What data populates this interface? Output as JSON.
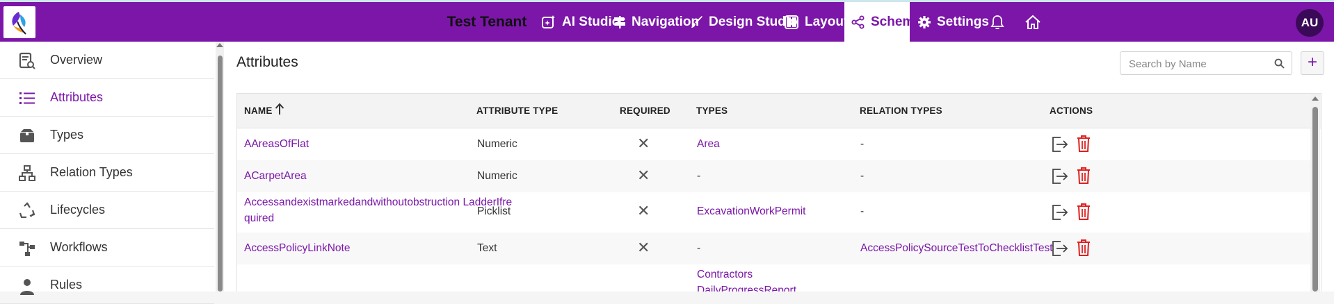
{
  "header": {
    "tenant": "Test Tenant",
    "nav": [
      {
        "label": "AI Studio",
        "icon": "ai-studio-icon"
      },
      {
        "label": "Navigation",
        "icon": "signpost-icon"
      },
      {
        "label": "Design Studio",
        "icon": "brush-icon"
      },
      {
        "label": "Layouts",
        "icon": "layout-icon"
      },
      {
        "label": "Schema",
        "icon": "share-icon",
        "active": true
      },
      {
        "label": "Settings",
        "icon": "gear-icon"
      }
    ],
    "avatar": "AU",
    "colors": {
      "primary": "#7b16a8",
      "avatar_bg": "#3a0a58"
    }
  },
  "sidebar": {
    "items": [
      {
        "label": "Overview",
        "icon": "overview-icon"
      },
      {
        "label": "Attributes",
        "icon": "list-icon",
        "active": true
      },
      {
        "label": "Types",
        "icon": "box-icon"
      },
      {
        "label": "Relation Types",
        "icon": "hierarchy-icon"
      },
      {
        "label": "Lifecycles",
        "icon": "recycle-icon"
      },
      {
        "label": "Workflows",
        "icon": "workflow-icon"
      },
      {
        "label": "Rules",
        "icon": "user-icon"
      }
    ]
  },
  "main": {
    "title": "Attributes",
    "search_placeholder": "Search by Name",
    "add_label": "+",
    "columns": [
      "NAME",
      "ATTRIBUTE TYPE",
      "REQUIRED",
      "TYPES",
      "RELATION TYPES",
      "ACTIONS"
    ],
    "rows": [
      {
        "name": "AAreasOfFlat",
        "attribute_type": "Numeric",
        "required": "✕",
        "types": "Area",
        "relation_types": "-"
      },
      {
        "name": "ACarpetArea",
        "attribute_type": "Numeric",
        "required": "✕",
        "types": "-",
        "relation_types": "-"
      },
      {
        "name_line1": "Accessandexistmarkedandwithoutobstruction LadderIfre",
        "name_line2": "quired",
        "attribute_type": "Picklist",
        "required": "✕",
        "types": "ExcavationWorkPermit",
        "relation_types": "-"
      },
      {
        "name": "AccessPolicyLinkNote",
        "attribute_type": "Text",
        "required": "✕",
        "types": "-",
        "relation_types": "AccessPolicySourceTestToChecklistTest"
      },
      {
        "types_line1": "Contractors",
        "types_line2": "DailyProgressReport"
      }
    ]
  }
}
